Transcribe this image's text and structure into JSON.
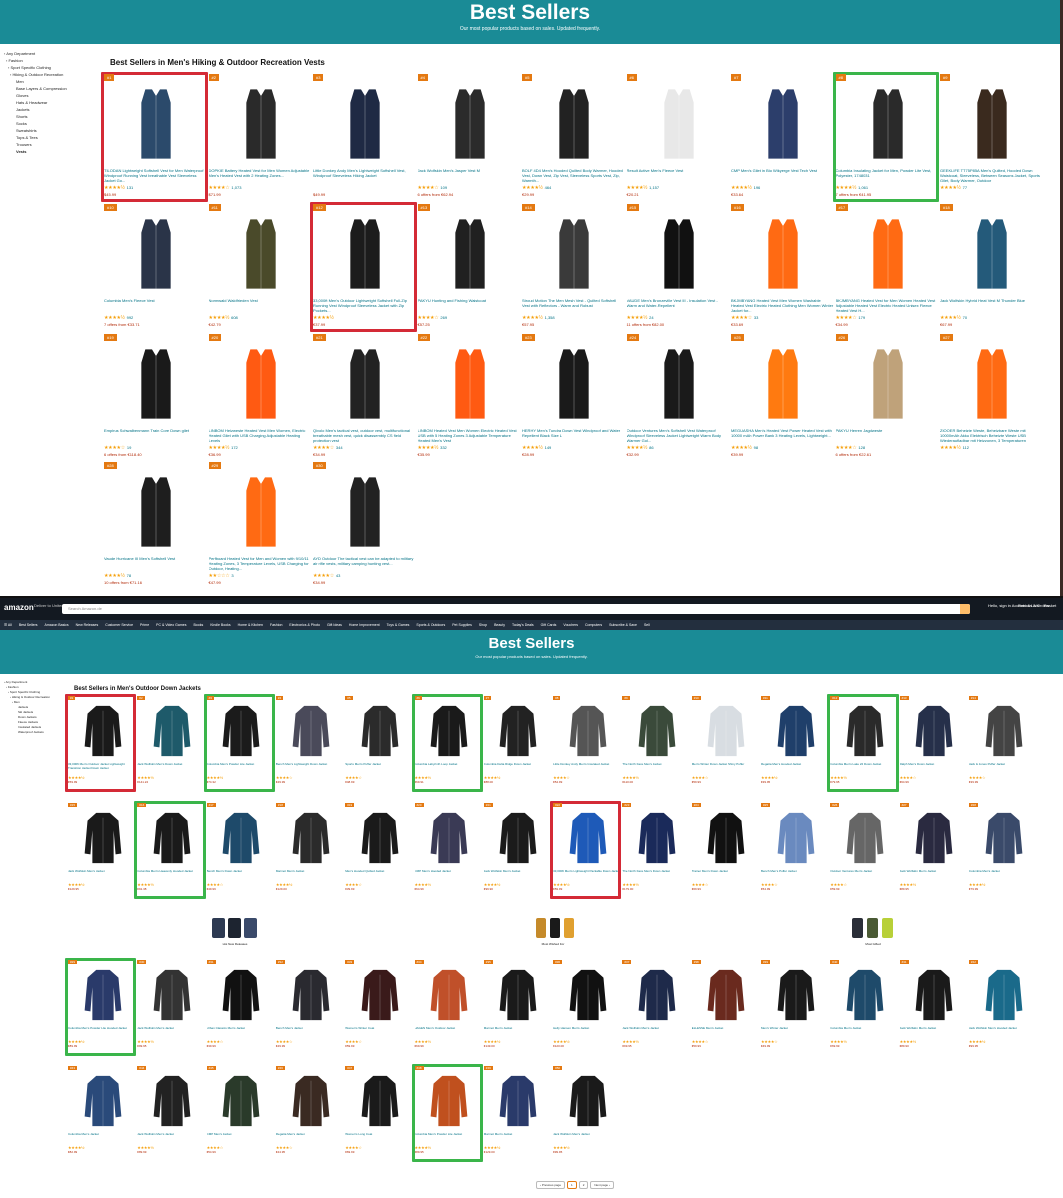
{
  "colors": {
    "teal": "#1a8b96",
    "orange_rank": "#e47911",
    "red_highlight": "#d42a36",
    "green_highlight": "#3ab54a",
    "star": "#f59f0a",
    "link": "#007185",
    "price": "#b12704"
  },
  "top": {
    "banner_title": "Best Sellers",
    "banner_subtitle": "Our most popular products based on sales. Updated frequently.",
    "heading": "Best Sellers in Men's Hiking & Outdoor Recreation Vests",
    "sidebar": [
      "‹ Any Department",
      "‹ Fashion",
      "‹ Sport Specific Clothing",
      "‹ Hiking & Outdoor Recreation",
      "Men",
      "Base Layers & Compression",
      "Gloves",
      "Hats & Headwear",
      "Jackets",
      "Shorts",
      "Socks",
      "Sweatshirts",
      "Tops & Tees",
      "Trousers",
      "Vests"
    ],
    "products": [
      {
        "rank": "#1",
        "title": "TILODAN Lightweight Softshell Vest for Men Waterproof Windproof Running Vest breathable Vest Sleeveless Jacket Go...",
        "stars": "★★★★½",
        "reviews": "131",
        "price": "$45.99",
        "hl": "red"
      },
      {
        "rank": "#2",
        "title": "DOPKIE Battery Heated Vest for Men Women Adjustable Men's Heated Vest with 2 Heating Zones...",
        "stars": "★★★★☆",
        "reviews": "1,073",
        "price": "$71.99"
      },
      {
        "rank": "#3",
        "title": "Little Donkey Andy Men's Lightweight Softshell Vest, Windproof Sleeveless Hiking Jacket",
        "stars": "",
        "reviews": "",
        "price": "$49.99"
      },
      {
        "rank": "#4",
        "title": "Jack Wolfskin Men's Jasper Vest M",
        "stars": "★★★★☆",
        "reviews": "109",
        "price": "6 offers from €62.94"
      },
      {
        "rank": "#5",
        "title": "BOLF 4D4 Men's Hooded Quilted Body Warmer, Hooded Vest, Down Vest, Zip Vest, Sleeveless Sports Vest, Zip, Warmth...",
        "stars": "★★★★½",
        "reviews": "464",
        "price": "€29.99"
      },
      {
        "rank": "#6",
        "title": "Result Active Men's Fleece Vest",
        "stars": "★★★★½",
        "reviews": "1,157",
        "price": "€20.21"
      },
      {
        "rank": "#7",
        "title": "CMP Men's Gilet in Bio Wikyerge Vest Tech Vest",
        "stars": "★★★★½",
        "reviews": "196",
        "price": "€33.64"
      },
      {
        "rank": "#8",
        "title": "Columbia Insulating Jacket for Men, Powder Lite Vest, Polyester, 1748031",
        "stars": "★★★★½",
        "reviews": "1,061",
        "price": "7 offers from €41.95",
        "hl": "green"
      },
      {
        "rank": "#9",
        "title": "GEEKLIFE TT75P85A Men's Quilted, Hooded Down Waistcoat, Sleeveless, Between Seasons Jacket, Sports Gilet, Body Warmer, Outdoor",
        "stars": "★★★★½",
        "reviews": "77",
        "price": ""
      },
      {
        "rank": "#10",
        "title": "Columbia Men's Fleece Vest",
        "stars": "★★★★½",
        "reviews": "992",
        "price": "7 offers from €33.71"
      },
      {
        "rank": "#11",
        "title": "Normwald Waldfrieden Vest",
        "stars": "★★★★½",
        "reviews": "608",
        "price": "€42.79"
      },
      {
        "rank": "#12",
        "title": "33,000ft Men's Outdoor Lightweight Softshell Full-Zip Running Vest Windproof Sleeveless Jacket with Zip Pockets...",
        "stars": "★★★★½",
        "reviews": "",
        "price": "€37.99",
        "hl": "red"
      },
      {
        "rank": "#13",
        "title": "PAKYU Hunting and Fishing Waistcoat",
        "stars": "★★★★☆",
        "reviews": "269",
        "price": "€57.25"
      },
      {
        "rank": "#14",
        "title": "Stroud Motion The Men Mesh Vest - Quilted Softshell Vest with Reflectors - Warm and Robust",
        "stars": "★★★★½",
        "reviews": "1,358",
        "price": "€57.95"
      },
      {
        "rank": "#15",
        "title": "VAUDE Men's Bronzeville Vest III - Insulation Vest - Warm and Water-Repellent",
        "stars": "★★★★½",
        "reviews": "24",
        "price": "11 offers from €82.00"
      },
      {
        "rank": "#16",
        "title": "BKJMBYANG Heated Vest Men Women Washable Heated Vest Electric Heated Clothing Men Women Winter Jacket for...",
        "stars": "★★★★☆",
        "reviews": "33",
        "price": "€33.69"
      },
      {
        "rank": "#17",
        "title": "BKJMBYANG Heated Vest for Men Women Heated Vest Adjustable Heated Vest Electric Heated Unisex Fleece Heated Vest H...",
        "stars": "★★★★☆",
        "reviews": "179",
        "price": "€34.99"
      },
      {
        "rank": "#18",
        "title": "Jack Wolfskin Hybrid Heat Vest M Thunder Blue",
        "stars": "★★★★½",
        "reviews": "70",
        "price": "€67.99"
      },
      {
        "rank": "#19",
        "title": "Empirus Schwalbenmann Train Core Down gilet",
        "stars": "★★★★☆",
        "reviews": "19",
        "price": "6 offers from €118.40"
      },
      {
        "rank": "#20",
        "title": "LINBOM Heizweste Heated Vest Men Women, Electric Heated Gilet with USB Charging Adjustable Heating Levels",
        "stars": "★★★★½",
        "reviews": "172",
        "price": "€36.99"
      },
      {
        "rank": "#21",
        "title": "Qivolo Men's tactical vest, outdoor vest, multifunctional breathable mesh vest, quick disassembly CS field protection vest",
        "stars": "★★★★☆",
        "reviews": "344",
        "price": "€34.99"
      },
      {
        "rank": "#22",
        "title": "LINBOM Heated Vest Men Women Electric Heated Vest USB with 5 Heating Zones 3 Adjustable Temperature Heated Men's Vest",
        "stars": "★★★★½",
        "reviews": "332",
        "price": "€35.99"
      },
      {
        "rank": "#23",
        "title": "HERHY Men's Tundra Down Vest Windproof and Water Repellent Black Size L",
        "stars": "★★★★½",
        "reviews": "149",
        "price": "€28.99"
      },
      {
        "rank": "#24",
        "title": "Outdoor Ventures Men's Softshell Vest Waterproof Windproof Sleeveless Jacket Lightweight Warm Body Warmer Gol...",
        "stars": "★★★★½",
        "reviews": "86",
        "price": "€32.99"
      },
      {
        "rank": "#25",
        "title": "MEGUASHA Men's Heated Vest Power Heated Vest with 10000 mAh Power Bank 3 Heating Levels, Lightweight...",
        "stars": "★★★★½",
        "reviews": "98",
        "price": "€39.99"
      },
      {
        "rank": "#26",
        "title": "PAKYU Herren Jagdweste",
        "stars": "★★★★☆",
        "reviews": "128",
        "price": "6 offers from €22.61"
      },
      {
        "rank": "#27",
        "title": "ZIOOER Beheizte Weste, Beheizbare Weste mit 10000mAh Akku Elektrisch Beheizte Weste USB Wiederaufladbar mit Heizzonen, 3 Temperaturen",
        "stars": "★★★★½",
        "reviews": "112",
        "price": ""
      },
      {
        "rank": "#28",
        "title": "Vaude Hurricane III Men's Softshell Vest",
        "stars": "★★★★½",
        "reviews": "78",
        "price": "10 offers from €71.16"
      },
      {
        "rank": "#29",
        "title": "Perfboard Heated Vest for Men and Women with 9/10/11 Heating Zones, 3 Temperature Levels, USB Charging for Outdoor, Heating...",
        "stars": "★★☆☆☆",
        "reviews": "3",
        "price": "€47.99"
      },
      {
        "rank": "#30",
        "title": "AYD Outdoor The tactical vest can be adapted to military air rifle vests, military camping hunting vest...",
        "stars": "★★★★☆",
        "reviews": "43",
        "price": "€34.99"
      }
    ]
  },
  "bottom": {
    "logo": "amazon",
    "deliver": "Deliver to United States",
    "search_placeholder": "Search Amazon.de",
    "account1": "Hello, sign in Account & Lists",
    "account2": "Returns & Orders",
    "cart": "Basket",
    "nav_links": [
      "☰ All",
      "Best Sellers",
      "Amazon Basics",
      "New Releases",
      "Customer Service",
      "Prime",
      "PC & Video Games",
      "Books",
      "Kindle Books",
      "Home & Kitchen",
      "Fashion",
      "Electronics & Photo",
      "Gift Ideas",
      "Home Improvement",
      "Toys & Games",
      "Sports & Outdoors",
      "Pet Supplies",
      "Shop",
      "Beauty",
      "Today's Deals",
      "Gift Cards",
      "Vouchers",
      "Computers",
      "Subscribe & Save",
      "Sell"
    ],
    "banner_title": "Best Sellers",
    "banner_subtitle": "Our most popular products based on sales. Updated frequently.",
    "heading": "Best Sellers in Men's Outdoor Down Jackets",
    "sidebar": [
      "‹ Any Department",
      "‹ Fashion",
      "‹ Sport Specific Clothing",
      "‹ Hiking & Outdoor Recreation",
      "‹ Men",
      "Jackets",
      "Ski Jackets",
      "Down Jackets",
      "Fleece Jackets",
      "Insulated Jackets",
      "Waterproof Jackets"
    ],
    "ads": [
      "Hot New Releases",
      "Most Wished For",
      "Most Gifted"
    ],
    "pagination": [
      "‹ Previous page",
      "1",
      "2",
      "Next page ›"
    ],
    "products": [
      {
        "rank": "#1",
        "title": "33,000ft Men's Outdoor Jacket Lightweight Transition Jacket Down Jacket",
        "stars": "★★★★½",
        "price": "€59.99",
        "hl": "red"
      },
      {
        "rank": "#2",
        "title": "Jack Wolfskin Men's Down Jacket",
        "stars": "★★★★½",
        "price": "€141.22"
      },
      {
        "rank": "#3",
        "title": "Columbia Men's Powder Lite Jacket",
        "stars": "★★★★½",
        "price": "€74.32",
        "hl": "green"
      },
      {
        "rank": "#4",
        "title": "Bench Men's Lightweight Down Jacket",
        "stars": "★★★★☆",
        "price": "€49.99"
      },
      {
        "rank": "#5",
        "title": "Sports Men's Puffer Jacket",
        "stars": "★★★★☆",
        "price": "€48.99"
      },
      {
        "rank": "#6",
        "title": "Columbia Labyrinth Loop Jacket",
        "stars": "★★★★½",
        "price": "€69.91",
        "hl": "green"
      },
      {
        "rank": "#7",
        "title": "Columbia Delta Ridge Down Jacket",
        "stars": "★★★★½",
        "price": "€88.00"
      },
      {
        "rank": "#8",
        "title": "Little Donkey Andy Men's Insulated Jacket",
        "stars": "★★★★☆",
        "price": "€54.99"
      },
      {
        "rank": "#9",
        "title": "The North Face Men's Jacket",
        "stars": "★★★★½",
        "price": "€110.00"
      },
      {
        "rank": "#10",
        "title": "Men's Winter Down Jacket Shiny Puffer",
        "stars": "★★★★☆",
        "price": "€59.99"
      },
      {
        "rank": "#11",
        "title": "Regatta Men's Hooded Jacket",
        "stars": "★★★★½",
        "price": "€39.95"
      },
      {
        "rank": "#12",
        "title": "Columbia Men's Lake 22 Down Jacket",
        "stars": "★★★★½",
        "price": "€79.95",
        "hl": "green"
      },
      {
        "rank": "#13",
        "title": "Ralph Men's Down Jacket",
        "stars": "★★★★☆",
        "price": "€64.99"
      },
      {
        "rank": "#14",
        "title": "Jack & Jones Puffer Jacket",
        "stars": "★★★★☆",
        "price": "€39.99"
      },
      {
        "rank": "#15",
        "title": "Jack Wolfskin Men's Jacket",
        "stars": "★★★★½",
        "price": "€129.95"
      },
      {
        "rank": "#16",
        "title": "Columbia Men's Heavenly Hooded Jacket",
        "stars": "★★★★½",
        "price": "€91.38",
        "hl": "green"
      },
      {
        "rank": "#17",
        "title": "Bench Men's Down Jacket",
        "stars": "★★★★☆",
        "price": "€49.99"
      },
      {
        "rank": "#18",
        "title": "Marmot Men's Jacket",
        "stars": "★★★★½",
        "price": "€129.00"
      },
      {
        "rank": "#19",
        "title": "Men's Hooded Quilted Jacket",
        "stars": "★★★★☆",
        "price": "€39.99"
      },
      {
        "rank": "#20",
        "title": "CMP Men's Hooded Jacket",
        "stars": "★★★★½",
        "price": "€64.99"
      },
      {
        "rank": "#21",
        "title": "Jack Wolfskin Men's Jacket",
        "stars": "★★★★½",
        "price": "€99.90"
      },
      {
        "rank": "#22",
        "title": "33,000ft Men's Lightweight Packable Down Jacket",
        "stars": "★★★★½",
        "price": "€59.99",
        "hl": "red"
      },
      {
        "rank": "#23",
        "title": "The North Face Men's Down Jacket",
        "stars": "★★★★½",
        "price": "€179.00"
      },
      {
        "rank": "#24",
        "title": "Trainer Men's Down Jacket",
        "stars": "★★★★☆",
        "price": "€69.99"
      },
      {
        "rank": "#25",
        "title": "Bench Men's Puffer Jacket",
        "stars": "★★★★☆",
        "price": "€54.99"
      },
      {
        "rank": "#26",
        "title": "Outdoor Ventures Men's Jacket",
        "stars": "★★★★☆",
        "price": "€59.99"
      },
      {
        "rank": "#27",
        "title": "Jack Wolfskin Men's Jacket",
        "stars": "★★★★½",
        "price": "€89.95"
      },
      {
        "rank": "#28",
        "title": "Columbia Men's Jacket",
        "stars": "★★★★½",
        "price": "€79.99"
      },
      {
        "rank": "#29",
        "title": "Columbia Men's Powder Lite Hooded Jacket",
        "stars": "★★★★½",
        "price": "€89.99",
        "hl": "green"
      },
      {
        "rank": "#30",
        "title": "Jack Wolfskin Men's Jacket",
        "stars": "★★★★½",
        "price": "€99.95"
      },
      {
        "rank": "#31",
        "title": "Urban Classics Men's Jacket",
        "stars": "★★★★☆",
        "price": "€39.99"
      },
      {
        "rank": "#32",
        "title": "Bench Men's Jacket",
        "stars": "★★★★☆",
        "price": "€49.99"
      },
      {
        "rank": "#33",
        "title": "Women's Winter Coat",
        "stars": "★★★★☆",
        "price": "€59.99"
      },
      {
        "rank": "#34",
        "title": "HAGEN Men's Outdoor Jacket",
        "stars": "★★★★½",
        "price": "€69.99"
      },
      {
        "rank": "#35",
        "title": "Marmot Men's Jacket",
        "stars": "★★★★½",
        "price": "€149.00"
      },
      {
        "rank": "#36",
        "title": "Helly Hansen Men's Jacket",
        "stars": "★★★★½",
        "price": "€120.00"
      },
      {
        "rank": "#37",
        "title": "Jack Wolfskin Men's Jacket",
        "stars": "★★★★½",
        "price": "€99.95"
      },
      {
        "rank": "#38",
        "title": "ELLESSE Men's Jacket",
        "stars": "★★★★☆",
        "price": "€59.99"
      },
      {
        "rank": "#39",
        "title": "Men's Winter Jacket",
        "stars": "★★★★☆",
        "price": "€49.99"
      },
      {
        "rank": "#40",
        "title": "Columbia Men's Jacket",
        "stars": "★★★★½",
        "price": "€69.99"
      },
      {
        "rank": "#41",
        "title": "Jack Wolfskin Men's Jacket",
        "stars": "★★★★½",
        "price": "€89.90"
      },
      {
        "rank": "#42",
        "title": "Jack Wolfskin Men's Hooded Jacket",
        "stars": "★★★★½",
        "price": "€99.95"
      },
      {
        "rank": "#43",
        "title": "Columbia Men's Jacket",
        "stars": "★★★★½",
        "price": "€82.99"
      },
      {
        "rank": "#44",
        "title": "Jack Wolfskin Men's Jacket",
        "stars": "★★★★½",
        "price": "€89.99"
      },
      {
        "rank": "#45",
        "title": "CMP Men's Jacket",
        "stars": "★★★★☆",
        "price": "€54.99"
      },
      {
        "rank": "#46",
        "title": "Regatta Men's Jacket",
        "stars": "★★★★☆",
        "price": "€44.95"
      },
      {
        "rank": "#47",
        "title": "Women's Long Coat",
        "stars": "★★★★☆",
        "price": "€69.99"
      },
      {
        "rank": "#48",
        "title": "Columbia Men's Powder Lite Jacket",
        "stars": "★★★★½",
        "price": "€89.95",
        "hl": "green"
      },
      {
        "rank": "#49",
        "title": "Marmot Men's Jacket",
        "stars": "★★★★½",
        "price": "€129.00"
      },
      {
        "rank": "#50",
        "title": "Jack Wolfskin Men's Jacket",
        "stars": "★★★★½",
        "price": "€99.95"
      }
    ]
  }
}
